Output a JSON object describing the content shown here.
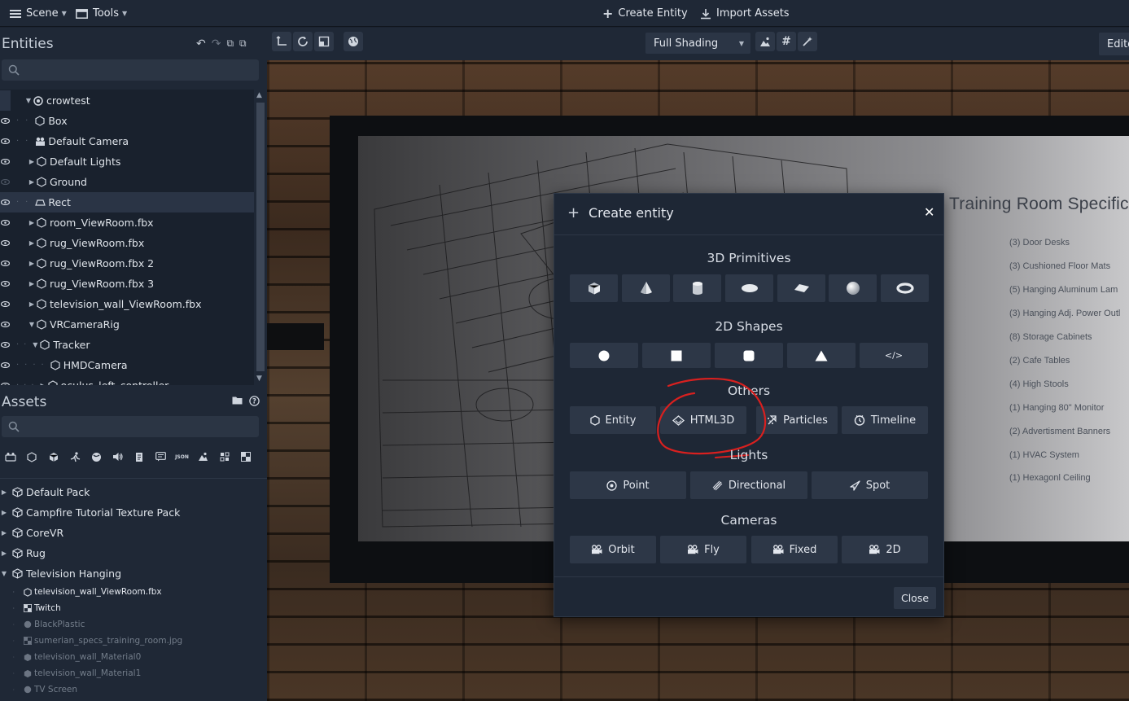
{
  "topbar": {
    "scene_label": "Scene",
    "tools_label": "Tools",
    "create_entity_label": "Create Entity",
    "import_assets_label": "Import Assets"
  },
  "entities": {
    "title": "Entities",
    "search_placeholder": "",
    "tree": [
      {
        "label": "crowtest",
        "icon": "scene-icon",
        "expanded": true
      },
      {
        "label": "Box",
        "icon": "hexagon-icon"
      },
      {
        "label": "Default Camera",
        "icon": "camera-icon"
      },
      {
        "label": "Default Lights",
        "icon": "hexagon-icon",
        "collapsed": true
      },
      {
        "label": "Ground",
        "icon": "hexagon-icon",
        "collapsed": true,
        "hidden": true
      },
      {
        "label": "Rect",
        "icon": "rect-icon",
        "selected": true
      },
      {
        "label": "room_ViewRoom.fbx",
        "icon": "hexagon-icon",
        "collapsed": true
      },
      {
        "label": "rug_ViewRoom.fbx",
        "icon": "hexagon-icon",
        "collapsed": true
      },
      {
        "label": "rug_ViewRoom.fbx 2",
        "icon": "hexagon-icon",
        "collapsed": true
      },
      {
        "label": "rug_ViewRoom.fbx 3",
        "icon": "hexagon-icon",
        "collapsed": true
      },
      {
        "label": "television_wall_ViewRoom.fbx",
        "icon": "hexagon-icon",
        "collapsed": true
      },
      {
        "label": "VRCameraRig",
        "icon": "hexagon-icon",
        "expanded": true
      },
      {
        "label": "Tracker",
        "icon": "hexagon-icon",
        "expanded": true
      },
      {
        "label": "HMDCamera",
        "icon": "hexagon-icon"
      },
      {
        "label": "oculus_left_controller",
        "icon": "hexagon-icon",
        "collapsed": true
      }
    ]
  },
  "assets": {
    "title": "Assets",
    "search_placeholder": "",
    "packs": [
      {
        "label": "Default Pack",
        "expanded": false
      },
      {
        "label": "Campfire Tutorial Texture Pack",
        "expanded": false
      },
      {
        "label": "CoreVR",
        "expanded": false
      },
      {
        "label": "Rug",
        "expanded": false
      },
      {
        "label": "Television Hanging",
        "expanded": true
      }
    ],
    "pack_items": [
      {
        "label": "television_wall_ViewRoom.fbx",
        "icon": "hexagon-icon",
        "active": true
      },
      {
        "label": "Twitch",
        "icon": "texture-icon",
        "active": true
      },
      {
        "label": "BlackPlastic",
        "icon": "material-icon",
        "active": false
      },
      {
        "label": "sumerian_specs_training_room.jpg",
        "icon": "texture-icon",
        "active": false
      },
      {
        "label": "television_wall_Material0",
        "icon": "cube-icon",
        "active": false
      },
      {
        "label": "television_wall_Material1",
        "icon": "cube-icon",
        "active": false
      },
      {
        "label": "TV Screen",
        "icon": "material-icon",
        "active": false
      }
    ]
  },
  "viewport": {
    "shading_label": "Full Shading",
    "editor_label": "Editor",
    "spec_title": "Training Room Specificat",
    "spec_items": [
      "(3) Door Desks",
      "(3) Cushioned Floor Mats",
      "(5) Hanging Aluminum Lam",
      "(3) Hanging Adj. Power Outl",
      "(8) Storage Cabinets",
      "(2) Cafe Tables",
      "(4) High Stools",
      "(1) Hanging 80\" Monitor",
      "(2) Advertisment Banners",
      "(1) HVAC System",
      "(1) Hexagonl Ceiling"
    ]
  },
  "modal": {
    "title": "Create entity",
    "sections": {
      "primitives": "3D Primitives",
      "shapes": "2D Shapes",
      "others": "Others",
      "lights": "Lights",
      "cameras": "Cameras"
    },
    "others": [
      "Entity",
      "HTML3D",
      "Particles",
      "Timeline"
    ],
    "lights": [
      "Point",
      "Directional",
      "Spot"
    ],
    "cameras": [
      "Orbit",
      "Fly",
      "Fixed",
      "2D"
    ],
    "shapes_html_label": "</>",
    "close_label": "Close",
    "annotation_color": "#d8201f"
  },
  "colors": {
    "panel_bg": "#1f2836",
    "button_bg": "#2d3747",
    "accent_annotation": "#d8201f"
  }
}
